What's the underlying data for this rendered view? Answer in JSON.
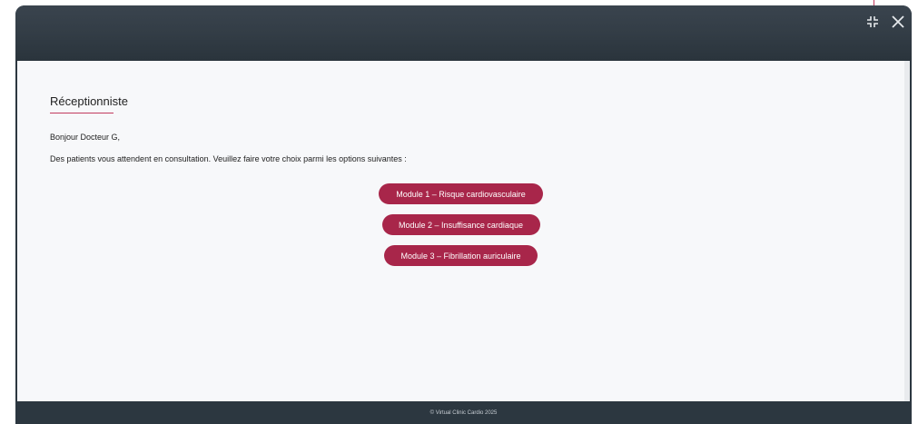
{
  "header": {
    "icons": [
      "exit-fullscreen-icon",
      "close-icon"
    ]
  },
  "content": {
    "title": "Réceptionniste",
    "greeting": "Bonjour Docteur G,",
    "instructions": "Des patients vous attendent en consultation. Veuillez faire votre choix parmi les options suivantes :",
    "modules": [
      {
        "label": "Module 1 – Risque cardiovasculaire"
      },
      {
        "label": "Module 2 – Insuffisance cardiaque"
      },
      {
        "label": "Module 3 – Fibrillation auriculaire"
      }
    ]
  },
  "footer": {
    "copyright": "© Virtual Clinic Cardio 2025"
  },
  "colors": {
    "header_bg": "#2c3740",
    "accent": "#a8264a",
    "content_bg": "#f7f8fa"
  }
}
